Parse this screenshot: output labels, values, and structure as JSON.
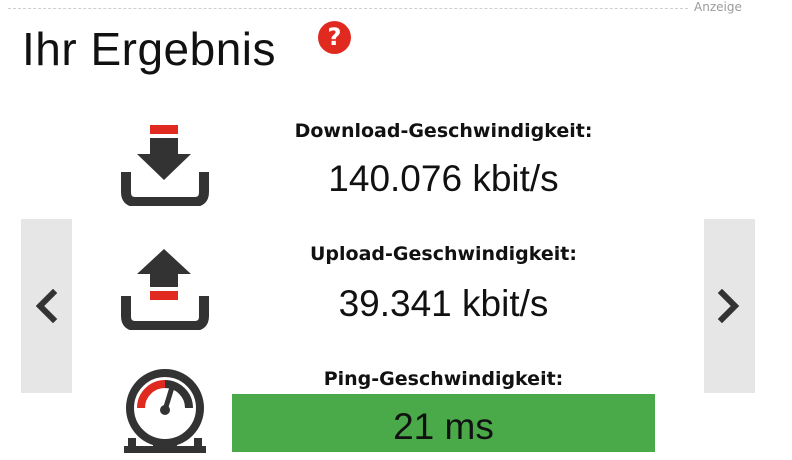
{
  "header": {
    "ad_label": "Anzeige",
    "title": "Ihr Ergebnis",
    "help_symbol": "?"
  },
  "navigation": {
    "prev_icon": "chevron-left-icon",
    "next_icon": "chevron-right-icon"
  },
  "metrics": {
    "download": {
      "label": "Download-Geschwindigkeit:",
      "value": "140.076 kbit/s",
      "icon": "download-icon"
    },
    "upload": {
      "label": "Upload-Geschwindigkeit:",
      "value": "39.341 kbit/s",
      "icon": "upload-icon"
    },
    "ping": {
      "label": "Ping-Geschwindigkeit:",
      "value": "21 ms",
      "icon": "gauge-icon"
    }
  },
  "colors": {
    "accent_red": "#e02a20",
    "icon_dark": "#333333",
    "ping_good_green": "#4aaa4a",
    "nav_bg": "#e6e6e6"
  }
}
